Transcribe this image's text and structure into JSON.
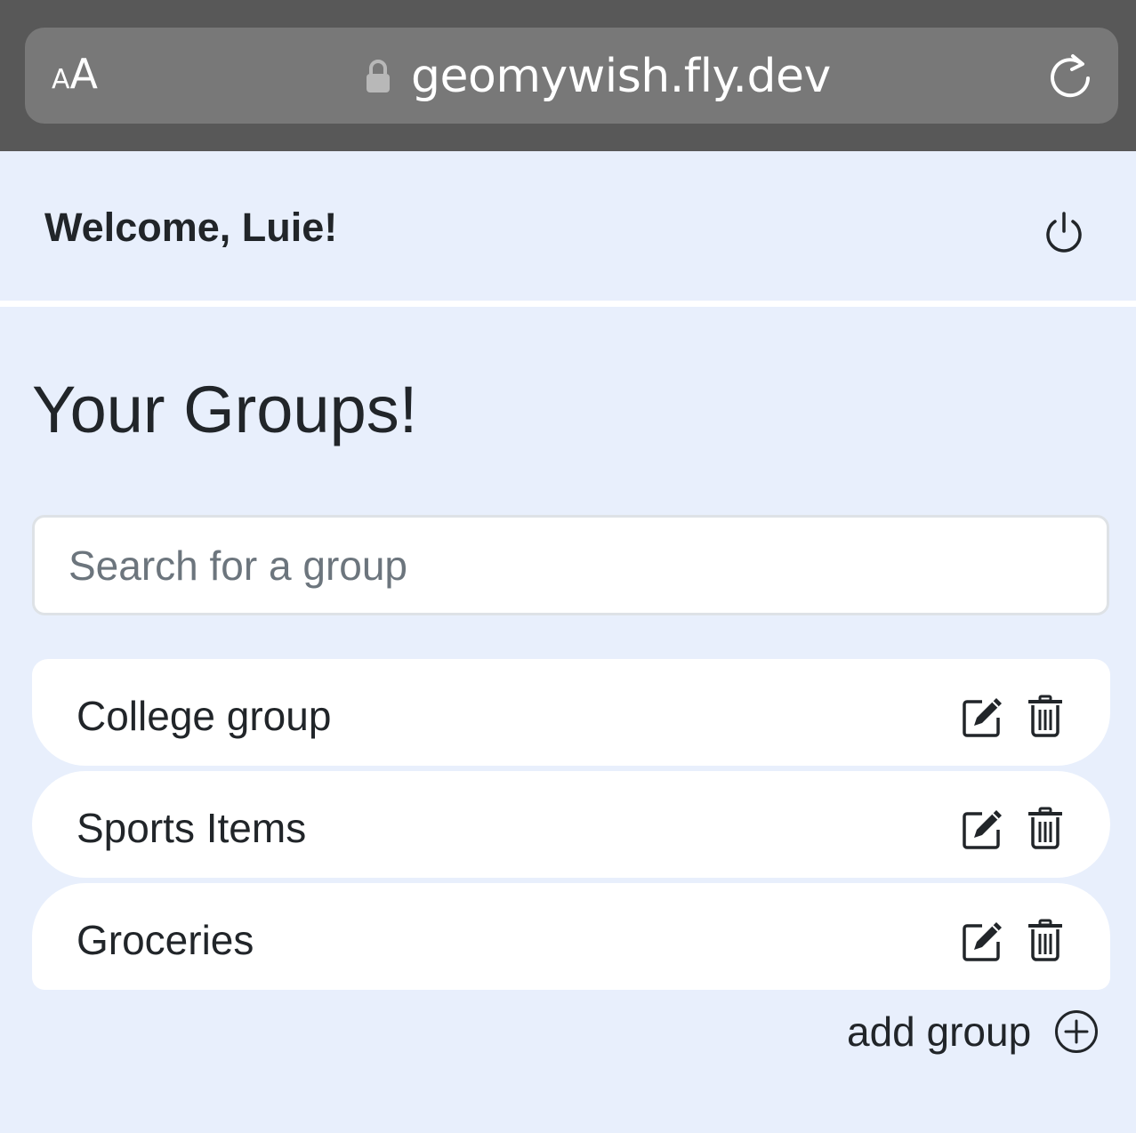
{
  "browser": {
    "text_size_small": "A",
    "text_size_big": "A",
    "url": "geomywish.fly.dev"
  },
  "navbar": {
    "welcome": "Welcome, Luie!"
  },
  "main": {
    "heading": "Your Groups!",
    "search_placeholder": "Search for a group",
    "groups": [
      {
        "name": "College group"
      },
      {
        "name": "Sports Items"
      },
      {
        "name": "Groceries"
      }
    ],
    "add_group_label": "add group"
  },
  "colors": {
    "page_bg": "#e8effc",
    "chrome_bg": "#585858",
    "addressbar_bg": "#787878",
    "text": "#212529"
  }
}
